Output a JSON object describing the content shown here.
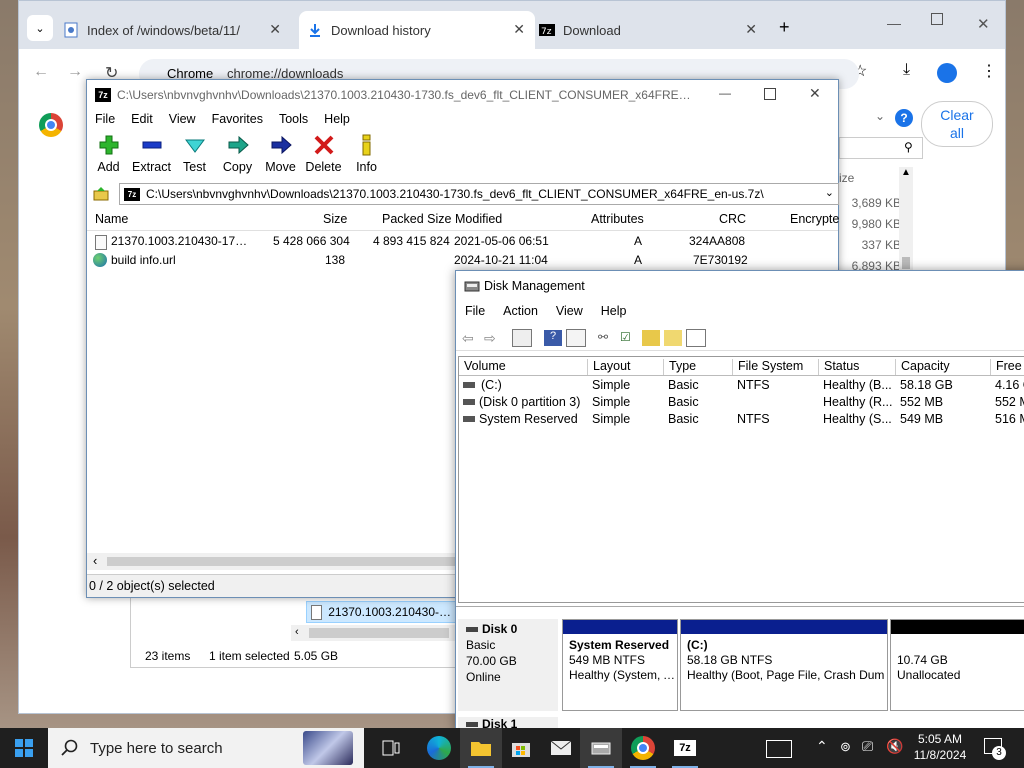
{
  "chrome": {
    "tabs": [
      {
        "title": "Index of /windows/beta/11/"
      },
      {
        "title": "Download history"
      },
      {
        "title": "Download"
      }
    ],
    "new_tab": "+",
    "omnibox_site": "Chrome",
    "omnibox_url": "chrome://downloads",
    "clear_all": "Clear all",
    "sizes": [
      "3,689 KB",
      "9,980 KB",
      "337 KB",
      "6,893 KB"
    ],
    "size_header": "ize",
    "behind_list": {
      "file": "21370.1003.210430-1730",
      "items": "23 items",
      "selected": "1 item selected",
      "size": "5.05 GB"
    }
  },
  "sevenzip": {
    "title": "C:\\Users\\nbvnvghvnhv\\Downloads\\21370.1003.210430-1730.fs_dev6_flt_CLIENT_CONSUMER_x64FRE_en-us.7z\\",
    "menu": [
      "File",
      "Edit",
      "View",
      "Favorites",
      "Tools",
      "Help"
    ],
    "toolbar": [
      "Add",
      "Extract",
      "Test",
      "Copy",
      "Move",
      "Delete",
      "Info"
    ],
    "path": "C:\\Users\\nbvnvghvnhv\\Downloads\\21370.1003.210430-1730.fs_dev6_flt_CLIENT_CONSUMER_x64FRE_en-us.7z\\",
    "columns": [
      "Name",
      "Size",
      "Packed Size",
      "Modified",
      "Attributes",
      "CRC",
      "Encrypte"
    ],
    "rows": [
      {
        "name": "21370.1003.210430-1730....",
        "size": "5 428 066 304",
        "packed": "4 893 415 824",
        "modified": "2021-05-06 06:51",
        "attr": "A",
        "crc": "324AA808"
      },
      {
        "name": "build info.url",
        "size": "138",
        "packed": "",
        "modified": "2024-10-21 11:04",
        "attr": "A",
        "crc": "7E730192"
      }
    ],
    "status": "0 / 2 object(s) selected"
  },
  "diskmgmt": {
    "title": "Disk Management",
    "menu": [
      "File",
      "Action",
      "View",
      "Help"
    ],
    "columns": [
      "Volume",
      "Layout",
      "Type",
      "File System",
      "Status",
      "Capacity",
      "Free S"
    ],
    "rows": [
      {
        "volume": "(C:)",
        "layout": "Simple",
        "type": "Basic",
        "fs": "NTFS",
        "status": "Healthy (B...",
        "capacity": "58.18 GB",
        "free": "4.16 G"
      },
      {
        "volume": "(Disk 0 partition 3)",
        "layout": "Simple",
        "type": "Basic",
        "fs": "",
        "status": "Healthy (R...",
        "capacity": "552 MB",
        "free": "552 M"
      },
      {
        "volume": "System Reserved",
        "layout": "Simple",
        "type": "Basic",
        "fs": "NTFS",
        "status": "Healthy (S...",
        "capacity": "549 MB",
        "free": "516 M"
      }
    ],
    "disk0": {
      "name": "Disk 0",
      "type": "Basic",
      "size": "70.00 GB",
      "state": "Online"
    },
    "partitions": [
      {
        "name": "System Reserved",
        "line1": "549 MB NTFS",
        "line2": "Healthy (System, Ac"
      },
      {
        "name": "(C:)",
        "line1": "58.18 GB NTFS",
        "line2": "Healthy (Boot, Page File, Crash Dum"
      },
      {
        "name": "",
        "line1": "10.74 GB",
        "line2": "Unallocated"
      }
    ],
    "disk1": "Disk 1"
  },
  "taskbar": {
    "search_placeholder": "Type here to search",
    "time": "5:05 AM",
    "date": "11/8/2024",
    "notification_count": "3"
  },
  "colors": {
    "accent": "#1a73e8",
    "partition_bar": "#0a1f8f",
    "unalloc_bar": "#000000",
    "taskbar": "#1f1f1f"
  }
}
